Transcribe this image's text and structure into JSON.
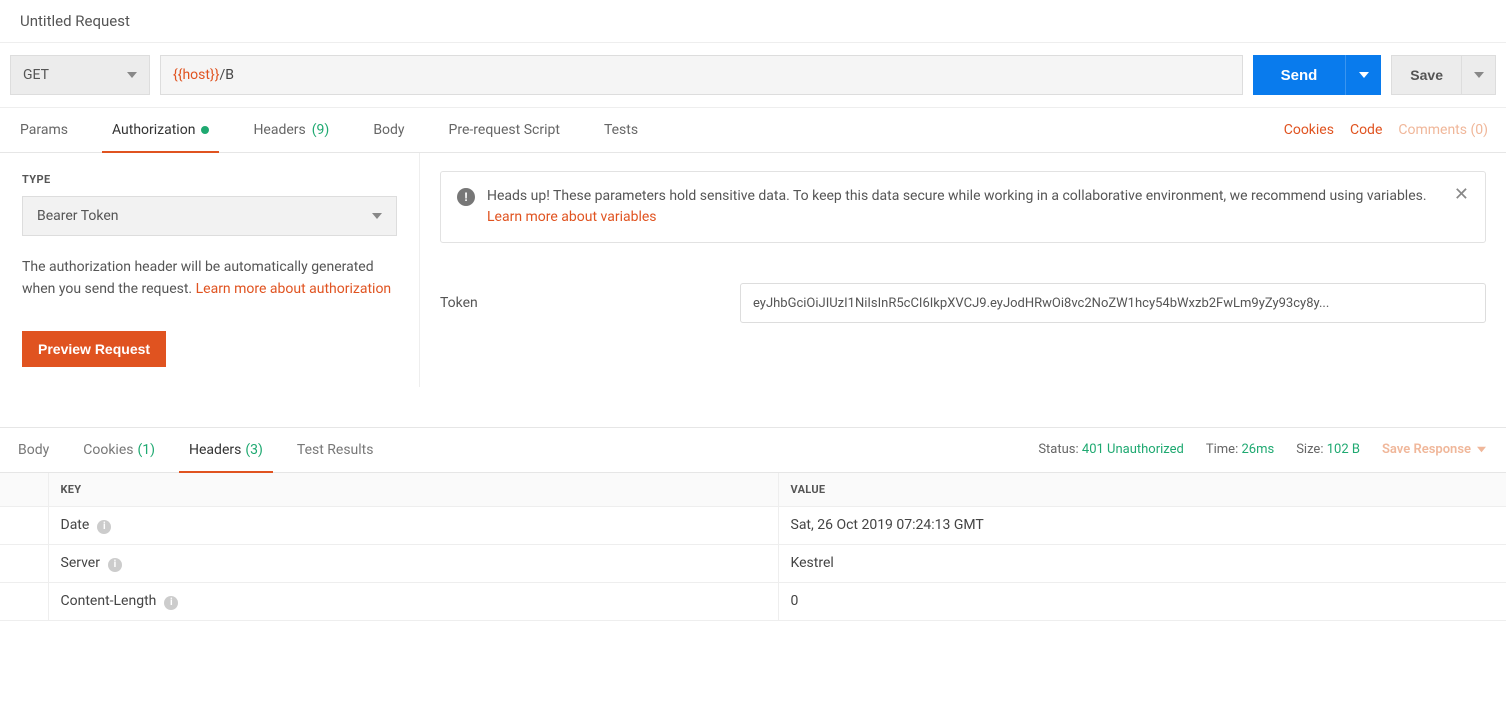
{
  "title": "Untitled Request",
  "request": {
    "method": "GET",
    "url_var": "{{host}}",
    "url_path": "/B",
    "send_label": "Send",
    "save_label": "Save"
  },
  "reqTabs": {
    "params": "Params",
    "authorization": "Authorization",
    "headers_label": "Headers",
    "headers_count": "(9)",
    "body": "Body",
    "prerequest": "Pre-request Script",
    "tests": "Tests"
  },
  "reqLinks": {
    "cookies": "Cookies",
    "code": "Code",
    "comments": "Comments (0)"
  },
  "auth": {
    "type_label": "TYPE",
    "type_value": "Bearer Token",
    "desc_pre": "The authorization header will be automatically generated when you send the request. ",
    "desc_link": "Learn more about authorization",
    "preview_btn": "Preview Request",
    "alert_text": "Heads up! These parameters hold sensitive data. To keep this data secure while working in a collaborative environment, we recommend using variables. ",
    "alert_link": "Learn more about variables",
    "token_label": "Token",
    "token_value": "eyJhbGciOiJIUzI1NiIsInR5cCI6IkpXVCJ9.eyJodHRwOi8vc2NoZW1hcy54bWxzb2FwLm9yZy93cy8y..."
  },
  "respTabs": {
    "body": "Body",
    "cookies_label": "Cookies",
    "cookies_count": "(1)",
    "headers_label": "Headers",
    "headers_count": "(3)",
    "tests": "Test Results"
  },
  "respMeta": {
    "status_label": "Status:",
    "status_value": "401 Unauthorized",
    "time_label": "Time:",
    "time_value": "26ms",
    "size_label": "Size:",
    "size_value": "102 B",
    "save_response": "Save Response"
  },
  "respHeaders": {
    "key_header": "KEY",
    "value_header": "VALUE",
    "rows": [
      {
        "key": "Date",
        "value": "Sat, 26 Oct 2019 07:24:13 GMT"
      },
      {
        "key": "Server",
        "value": "Kestrel"
      },
      {
        "key": "Content-Length",
        "value": "0"
      }
    ]
  }
}
